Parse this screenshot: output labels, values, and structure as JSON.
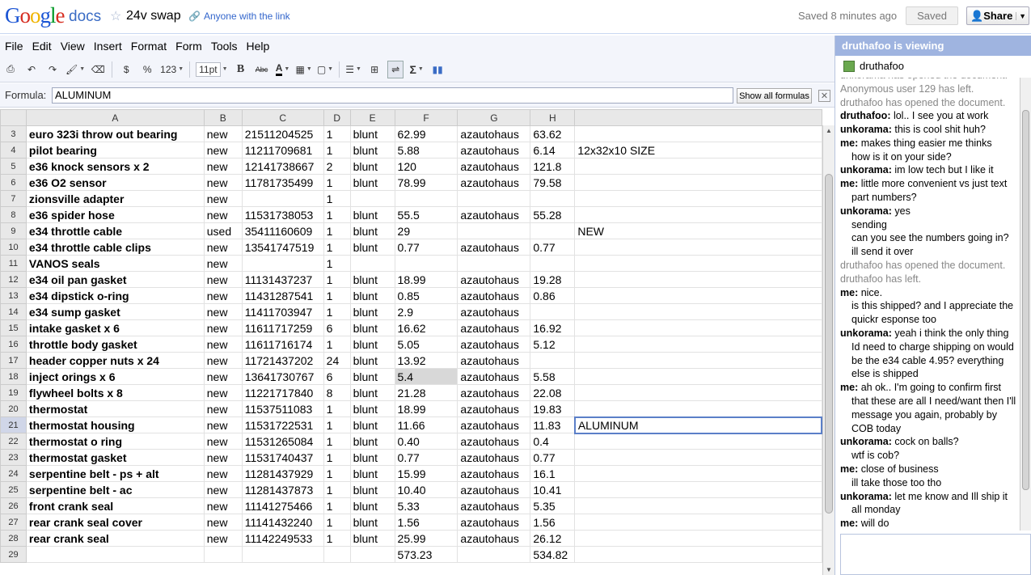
{
  "header": {
    "logo": [
      "G",
      "o",
      "o",
      "g",
      "l",
      "e"
    ],
    "product": "docs",
    "title": "24v swap",
    "share_link": "Anyone with the link",
    "saved_msg": "Saved 8 minutes ago",
    "saved_btn": "Saved",
    "share_btn": "Share"
  },
  "menu": [
    "File",
    "Edit",
    "View",
    "Insert",
    "Format",
    "Form",
    "Tools",
    "Help"
  ],
  "toolbar": {
    "currency": "$",
    "percent": "%",
    "number_format": "123",
    "font_size": "11pt",
    "bold": "B",
    "strike": "Abc",
    "text_color": "A",
    "sigma": "Σ"
  },
  "formula": {
    "label": "Formula:",
    "value": "ALUMINUM",
    "show_all": "Show all formulas"
  },
  "grid": {
    "columns": [
      "A",
      "B",
      "C",
      "D",
      "E",
      "F",
      "G",
      "H",
      ""
    ],
    "rows": [
      {
        "n": "3",
        "a": "euro 323i throw out bearing",
        "b": "new",
        "c": "21511204525",
        "d": "1",
        "e": "blunt",
        "f": "62.99",
        "g": "azautohaus",
        "h": "63.62",
        "i": ""
      },
      {
        "n": "4",
        "a": "pilot bearing",
        "b": "new",
        "c": "11211709681",
        "d": "1",
        "e": "blunt",
        "f": "5.88",
        "g": "azautohaus",
        "h": "6.14",
        "i": "12x32x10 SIZE"
      },
      {
        "n": "5",
        "a": "e36 knock sensors x 2",
        "b": "new",
        "c": "12141738667",
        "d": "2",
        "e": "blunt",
        "f": "120",
        "g": "azautohaus",
        "h": "121.8",
        "i": ""
      },
      {
        "n": "6",
        "a": "e36 O2 sensor",
        "b": "new",
        "c": "11781735499",
        "d": "1",
        "e": "blunt",
        "f": "78.99",
        "g": "azautohaus",
        "h": "79.58",
        "i": ""
      },
      {
        "n": "7",
        "a": "zionsville adapter",
        "b": "new",
        "c": "",
        "d": "1",
        "e": "",
        "f": "",
        "g": "",
        "h": "",
        "i": ""
      },
      {
        "n": "8",
        "a": "e36 spider hose",
        "b": "new",
        "c": "11531738053",
        "d": "1",
        "e": "blunt",
        "f": "55.5",
        "g": "azautohaus",
        "h": "55.28",
        "i": ""
      },
      {
        "n": "9",
        "a": "e34 throttle cable",
        "b": "used",
        "c": "35411160609",
        "d": "1",
        "e": "blunt",
        "f": "29",
        "g": "",
        "h": "",
        "i": "NEW"
      },
      {
        "n": "10",
        "a": "e34 throttle cable clips",
        "b": "new",
        "c": "13541747519",
        "d": "1",
        "e": "blunt",
        "f": "0.77",
        "g": "azautohaus",
        "h": "0.77",
        "i": ""
      },
      {
        "n": "11",
        "a": "VANOS seals",
        "b": "new",
        "c": "",
        "d": "1",
        "e": "",
        "f": "",
        "g": "",
        "h": "",
        "i": ""
      },
      {
        "n": "12",
        "a": "e34 oil pan gasket",
        "b": "new",
        "c": "11131437237",
        "d": "1",
        "e": "blunt",
        "f": "18.99",
        "g": "azautohaus",
        "h": "19.28",
        "i": ""
      },
      {
        "n": "13",
        "a": "e34 dipstick o-ring",
        "b": "new",
        "c": "11431287541",
        "d": "1",
        "e": "blunt",
        "f": "0.85",
        "g": "azautohaus",
        "h": "0.86",
        "i": ""
      },
      {
        "n": "14",
        "a": "e34 sump gasket",
        "b": "new",
        "c": "11411703947",
        "d": "1",
        "e": "blunt",
        "f": "2.9",
        "g": "azautohaus",
        "h": "",
        "i": ""
      },
      {
        "n": "15",
        "a": "intake gasket x 6",
        "b": "new",
        "c": "11611717259",
        "d": "6",
        "e": "blunt",
        "f": "16.62",
        "g": "azautohaus",
        "h": "16.92",
        "i": ""
      },
      {
        "n": "16",
        "a": "throttle body gasket",
        "b": "new",
        "c": "11611716174",
        "d": "1",
        "e": "blunt",
        "f": "5.05",
        "g": "azautohaus",
        "h": "5.12",
        "i": ""
      },
      {
        "n": "17",
        "a": "header copper nuts x 24",
        "b": "new",
        "c": "11721437202",
        "d": "24",
        "e": "blunt",
        "f": "13.92",
        "g": "azautohaus",
        "h": "",
        "i": ""
      },
      {
        "n": "18",
        "a": "inject orings x 6",
        "b": "new",
        "c": "13641730767",
        "d": "6",
        "e": "blunt",
        "f": "5.4",
        "g": "azautohaus",
        "h": "5.58",
        "i": ""
      },
      {
        "n": "19",
        "a": "flywheel bolts x 8",
        "b": "new",
        "c": "11221717840",
        "d": "8",
        "e": "blunt",
        "f": "21.28",
        "g": "azautohaus",
        "h": "22.08",
        "i": ""
      },
      {
        "n": "20",
        "a": "thermostat",
        "b": "new",
        "c": "11537511083",
        "d": "1",
        "e": "blunt",
        "f": "18.99",
        "g": "azautohaus",
        "h": "19.83",
        "i": ""
      },
      {
        "n": "21",
        "a": "thermostat housing",
        "b": "new",
        "c": "11531722531",
        "d": "1",
        "e": "blunt",
        "f": "11.66",
        "g": "azautohaus",
        "h": "11.83",
        "i": "ALUMINUM"
      },
      {
        "n": "22",
        "a": "thermostat o ring",
        "b": "new",
        "c": "11531265084",
        "d": "1",
        "e": "blunt",
        "f": "0.40",
        "g": "azautohaus",
        "h": "0.4",
        "i": ""
      },
      {
        "n": "23",
        "a": "thermostat gasket",
        "b": "new",
        "c": "11531740437",
        "d": "1",
        "e": "blunt",
        "f": "0.77",
        "g": "azautohaus",
        "h": "0.77",
        "i": ""
      },
      {
        "n": "24",
        "a": "serpentine belt - ps + alt",
        "b": "new",
        "c": "11281437929",
        "d": "1",
        "e": "blunt",
        "f": "15.99",
        "g": "azautohaus",
        "h": "16.1",
        "i": ""
      },
      {
        "n": "25",
        "a": "serpentine belt - ac",
        "b": "new",
        "c": "11281437873",
        "d": "1",
        "e": "blunt",
        "f": "10.40",
        "g": "azautohaus",
        "h": "10.41",
        "i": ""
      },
      {
        "n": "26",
        "a": "front crank seal",
        "b": "new",
        "c": "11141275466",
        "d": "1",
        "e": "blunt",
        "f": "5.33",
        "g": "azautohaus",
        "h": "5.35",
        "i": ""
      },
      {
        "n": "27",
        "a": "rear crank seal cover",
        "b": "new",
        "c": "11141432240",
        "d": "1",
        "e": "blunt",
        "f": "1.56",
        "g": "azautohaus",
        "h": "1.56",
        "i": ""
      },
      {
        "n": "28",
        "a": "rear crank seal",
        "b": "new",
        "c": "11142249533",
        "d": "1",
        "e": "blunt",
        "f": "25.99",
        "g": "azautohaus",
        "h": "26.12",
        "i": ""
      },
      {
        "n": "29",
        "a": "",
        "b": "",
        "c": "",
        "d": "",
        "e": "",
        "f": "573.23",
        "g": "",
        "h": "534.82",
        "i": ""
      }
    ]
  },
  "sidebar": {
    "heading": "druthafoo is viewing",
    "viewer": "druthafoo",
    "chat": [
      {
        "type": "sys",
        "text": "unkorama has opened the document."
      },
      {
        "type": "sys",
        "text": "Anonymous user 129 has left."
      },
      {
        "type": "sys",
        "text": "druthafoo has opened the document."
      },
      {
        "type": "msg",
        "who": "druthafoo:",
        "text": " lol.. I see you at work"
      },
      {
        "type": "msg",
        "who": "unkorama:",
        "text": " this is cool shit huh?"
      },
      {
        "type": "msg",
        "who": "me:",
        "text": " makes thing easier me thinks"
      },
      {
        "type": "cont",
        "text": "how is it on your side?"
      },
      {
        "type": "msg",
        "who": "unkorama:",
        "text": " im low tech but I like it"
      },
      {
        "type": "msg",
        "who": "me:",
        "text": " little more convenient vs just text part numbers?"
      },
      {
        "type": "msg",
        "who": "unkorama:",
        "text": " yes"
      },
      {
        "type": "cont",
        "text": "sending"
      },
      {
        "type": "cont",
        "text": "can you see the numbers going in?"
      },
      {
        "type": "cont",
        "text": "ill send it over"
      },
      {
        "type": "sys",
        "text": "druthafoo has opened the document."
      },
      {
        "type": "sys",
        "text": "druthafoo has left."
      },
      {
        "type": "msg",
        "who": "me:",
        "text": " nice."
      },
      {
        "type": "cont",
        "text": "is this shipped? and I appreciate the quickr esponse too"
      },
      {
        "type": "msg",
        "who": "unkorama:",
        "text": " yeah i think the only thing Id need to charge shipping on would be the e34 cable 4.95? everything else is shipped"
      },
      {
        "type": "msg",
        "who": "me:",
        "text": " ah ok.. I'm going to confirm first that these are all I need/want then I'll message you again, probably by COB today"
      },
      {
        "type": "msg",
        "who": "unkorama:",
        "text": " cock on balls?"
      },
      {
        "type": "cont",
        "text": "wtf is cob?"
      },
      {
        "type": "msg",
        "who": "me:",
        "text": " close of business"
      },
      {
        "type": "cont",
        "text": "ill take those too tho"
      },
      {
        "type": "msg",
        "who": "unkorama:",
        "text": " let me know and Ill ship it all monday"
      },
      {
        "type": "msg",
        "who": "me:",
        "text": " will do"
      }
    ]
  }
}
